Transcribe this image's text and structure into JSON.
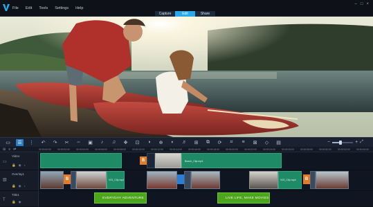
{
  "menu": {
    "items": [
      "File",
      "Edit",
      "Tools",
      "Settings",
      "Help"
    ]
  },
  "steps": {
    "tabs": [
      {
        "label": "Capture",
        "active": false
      },
      {
        "label": "Edit",
        "active": true
      },
      {
        "label": "Share",
        "active": false
      }
    ]
  },
  "toolbar": {
    "zoom_minus": "−",
    "zoom_plus": "+"
  },
  "ruler": {
    "timecodes": [
      "00:00:00:00",
      "00:00:02:00",
      "00:00:04:00",
      "00:00:06:00",
      "00:00:08:00",
      "00:00:10:00",
      "00:00:12:00",
      "00:00:14:00",
      "00:00:16:00",
      "00:00:18:00",
      "00:00:20:00",
      "00:00:22:00",
      "00:00:24:00",
      "00:00:26:00",
      "00:00:28:00",
      "00:00:30:00",
      "00:00:32:00",
      "00:00:34:00"
    ]
  },
  "tracks": {
    "video": {
      "name": "Video"
    },
    "overlay": {
      "name": "Overlay1"
    },
    "title": {
      "name": "Title1"
    }
  },
  "clips": {
    "video_clip_label": "Beach_Clip.mp4",
    "overlay_clip_label_1": "V01_Clip.mp4",
    "overlay_clip_label_2": "V02_Clip.mp4",
    "title_1": "EVERYDAY ADVENTURE",
    "title_2": "LIVE LIFE, MAKE MOVIES",
    "trans_1": "B",
    "trans_2": "B",
    "trans_3": "B"
  },
  "colors": {
    "accent": "#2aa8e8",
    "video_clip": "#1f8a66",
    "title_clip": "#4ca51d",
    "transition": "#e37c2a"
  }
}
